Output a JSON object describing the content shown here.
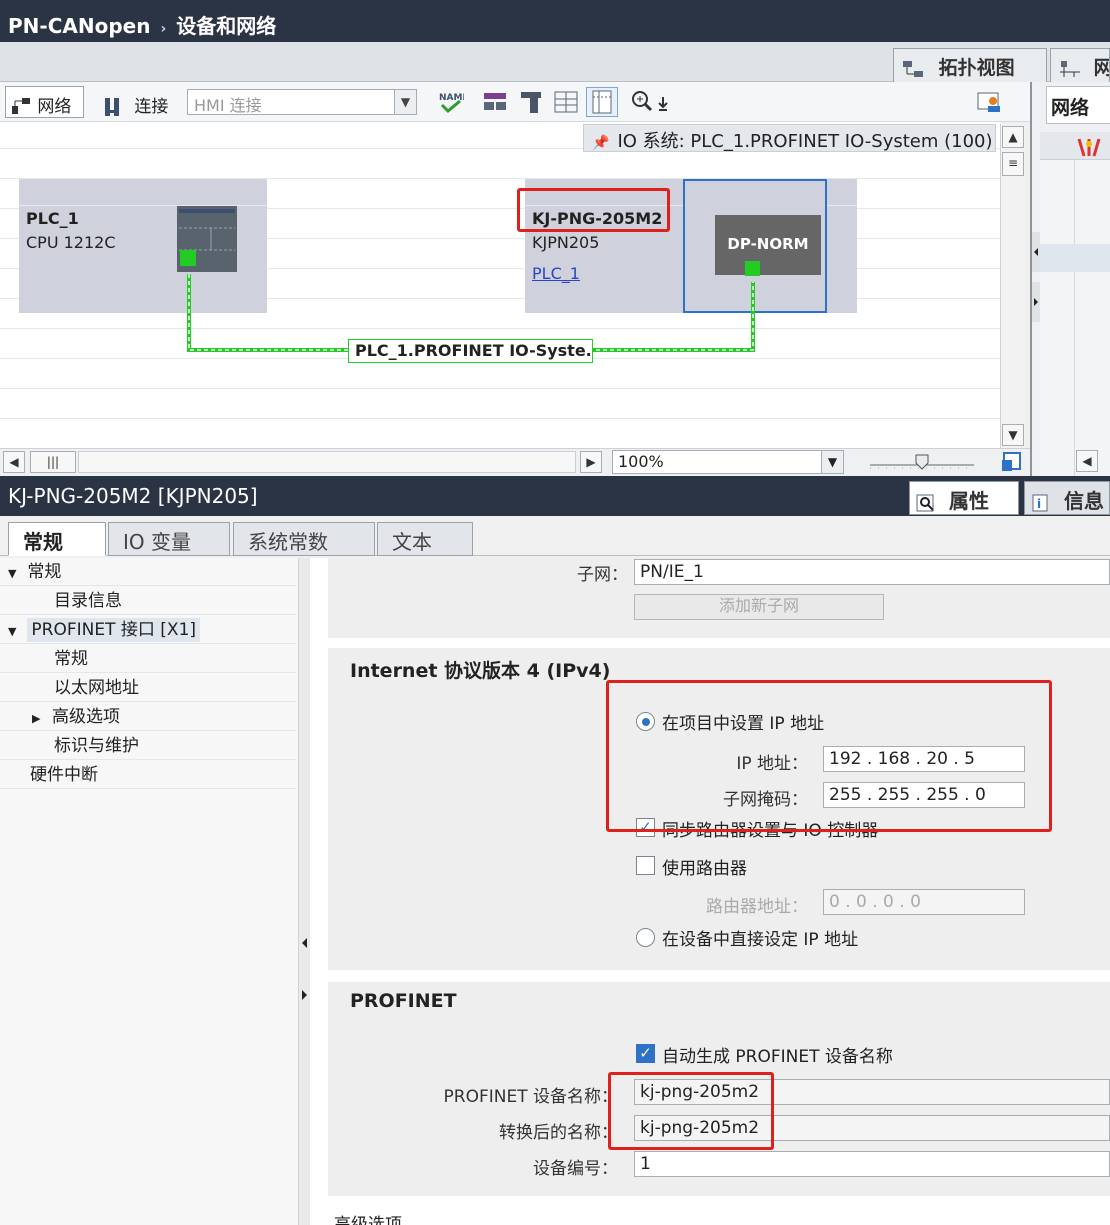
{
  "title": {
    "project": "PN-CANopen",
    "separator": "›",
    "view": "设备和网络"
  },
  "view_tabs": {
    "topology": "拓扑视图",
    "network_cut": "网"
  },
  "toolbar": {
    "network_label": "网络",
    "connect_label": "连接",
    "hmi_connect": "HMI 连接",
    "network_tab_right": "网络"
  },
  "canvas": {
    "io_system_bar": "IO 系统: PLC_1.PROFINET IO-System (100)",
    "plc": {
      "name": "PLC_1",
      "type": "CPU 1212C"
    },
    "device": {
      "name": "KJ-PNG-205M2",
      "type": "KJPN205",
      "link": "PLC_1",
      "module": "DP-NORM"
    },
    "network_label": "PLC_1.PROFINET  IO-Syste..."
  },
  "zoom": "100%",
  "props_header": {
    "title": "KJ-PNG-205M2 [KJPN205]",
    "properties_tab": "属性",
    "info_tab": "信息"
  },
  "prop_tabs": [
    "常规",
    "IO 变量",
    "系统常数",
    "文本"
  ],
  "tree": {
    "general": "常规",
    "catalog_info": "目录信息",
    "profinet_interface": "PROFINET 接口 [X1]",
    "pi_general": "常规",
    "ethernet_address": "以太网地址",
    "advanced_options": "高级选项",
    "id_maintenance": "标识与维护",
    "hardware_interrupt": "硬件中断"
  },
  "subnet": {
    "label": "子网：",
    "value": "PN/IE_1",
    "add_button": "添加新子网"
  },
  "ipv4": {
    "title": "Internet 协议版本 4 (IPv4)",
    "set_in_project": "在项目中设置 IP 地址",
    "ip_label": "IP 地址：",
    "ip_value": "192 . 168 . 20   . 5",
    "mask_label": "子网掩码：",
    "mask_value": "255 . 255 . 255 . 0",
    "sync_router": "同步路由器设置与 IO 控制器",
    "use_router": "使用路由器",
    "router_label": "路由器地址：",
    "router_value": "0     . 0     . 0     . 0",
    "set_on_device": "在设备中直接设定 IP 地址"
  },
  "profinet": {
    "title": "PROFINET",
    "auto_name": "自动生成 PROFINET 设备名称",
    "device_name_label": "PROFINET 设备名称：",
    "device_name_value": "kj-png-205m2",
    "converted_label": "转换后的名称：",
    "converted_value": "kj-png-205m2",
    "device_number_label": "设备编号：",
    "device_number_value": "1"
  },
  "advanced_footer": "高级选项",
  "colors": {
    "title_bar": "#2b3444",
    "highlight_red": "#e0201a",
    "profinet_green": "#22cc22",
    "device_bg": "#cfd1dc",
    "selection_blue": "#2e72c7"
  }
}
